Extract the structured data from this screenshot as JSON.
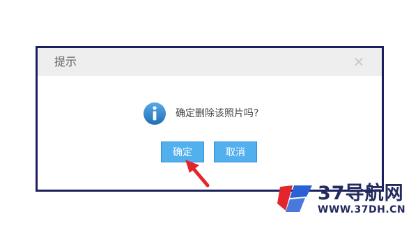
{
  "dialog": {
    "title": "提示",
    "close_glyph": "×",
    "icon": "info-icon",
    "message": "确定删除该照片吗?",
    "ok_label": "确定",
    "cancel_label": "取消"
  },
  "watermark": {
    "title": "37导航网",
    "url": "WWW.37DH.CN"
  },
  "colors": {
    "dialog_border": "#1b1f5e",
    "header_bg": "#eeeeee",
    "button_bg": "#52b0ef",
    "info_icon": "#2f86c9",
    "arrow": "#e3262d"
  }
}
